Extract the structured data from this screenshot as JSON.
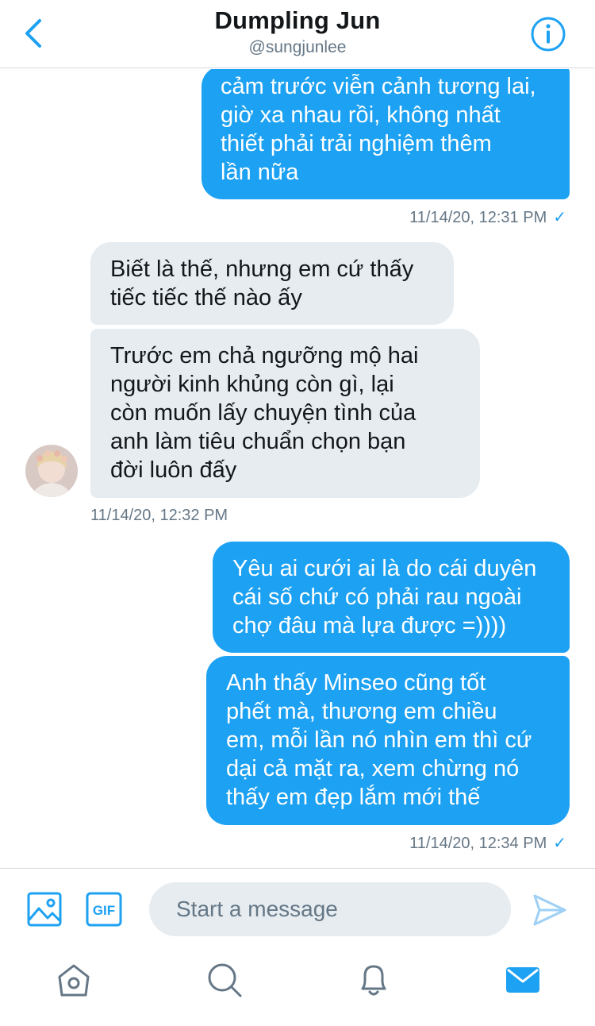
{
  "header": {
    "title": "Dumpling Jun",
    "handle": "@sungjunlee"
  },
  "messages": [
    {
      "direction": "outgoing",
      "text": "cảm trước viễn cảnh tương lai,\ngiờ xa nhau rồi, không nhất\nthiết phải trải nghiệm thêm\nlần nữa"
    },
    {
      "direction": "incoming",
      "text": "Biết là thế, nhưng em cứ thấy\ntiếc tiếc thế nào ấy"
    },
    {
      "direction": "incoming",
      "text": "Trước em chả ngưỡng mộ hai\nngười kinh khủng còn gì, lại\ncòn muốn lấy chuyện tình của\nanh làm tiêu chuẩn chọn bạn\nđời luôn đấy"
    },
    {
      "direction": "outgoing",
      "text": "Yêu ai cưới ai là do cái duyên\ncái số chứ có phải rau ngoài\nchợ đâu mà lựa được =))))"
    },
    {
      "direction": "outgoing",
      "text": "Anh thấy Minseo cũng tốt\nphết mà, thương em chiều\nem, mỗi lần nó nhìn em thì cứ\ndại cả mặt ra, xem chừng nó\nthấy em đẹp lắm mới thế"
    }
  ],
  "timestamps": {
    "first": "11/14/20, 12:31 PM",
    "second": "11/14/20, 12:32 PM",
    "third": "11/14/20, 12:34 PM",
    "read_mark": "✓"
  },
  "composer": {
    "placeholder": "Start a message",
    "gif_label": "GIF"
  },
  "icons": {
    "back": "chevron-left-icon",
    "info": "info-icon",
    "media": "image-icon",
    "gif": "gif-icon",
    "send": "send-icon",
    "home": "home-icon",
    "search": "search-icon",
    "notifications": "bell-icon",
    "messages": "envelope-icon"
  },
  "colors": {
    "accent": "#1da1f2",
    "incoming_bubble": "#e6ecf0",
    "muted_text": "#657786"
  }
}
